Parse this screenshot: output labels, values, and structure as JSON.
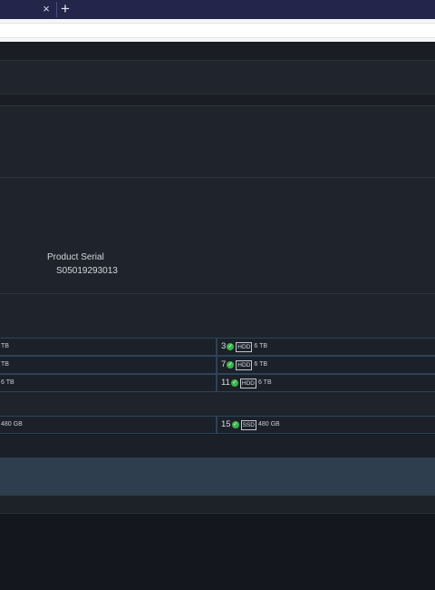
{
  "browser": {
    "tab_close_glyph": "×",
    "new_tab_glyph": "+"
  },
  "device": {
    "serial_label": "Product Serial",
    "serial_value": "S05019293013"
  },
  "hdd_rows": [
    {
      "left_size": "TB",
      "right_slot": "3",
      "right_type": "HDD",
      "right_size": "6 TB"
    },
    {
      "left_size": "TB",
      "right_slot": "7",
      "right_type": "HDD",
      "right_size": "6 TB"
    },
    {
      "left_size": "6 TB",
      "right_slot": "11",
      "right_type": "HDD",
      "right_size": "6 TB"
    }
  ],
  "ssd_row": {
    "left_size": "480 GB",
    "right_slot": "15",
    "right_type": "SSD",
    "right_size": "480 GB"
  },
  "status_icon": "check-circle-icon",
  "colors": {
    "ok": "#39b54a",
    "accent_band": "#2e3e4e"
  }
}
